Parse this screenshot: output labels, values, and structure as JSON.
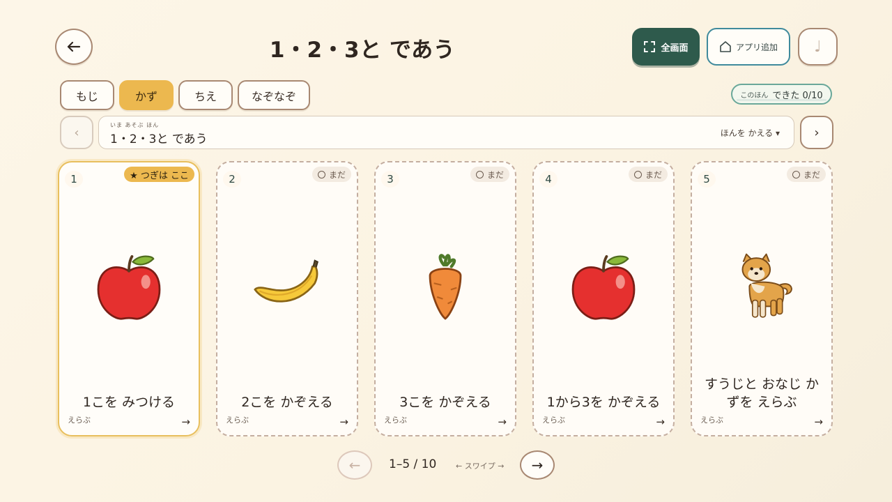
{
  "header": {
    "back_icon": "arrow-left-icon",
    "title": "1・2・3と であう",
    "fullscreen_label": "全画面",
    "fullscreen_icon": "expand-corners-icon",
    "add_app_label": "アプリ追加",
    "add_app_icon": "home-icon",
    "music_icon": "music-note-icon"
  },
  "tabs": [
    {
      "label": "もじ",
      "active": false
    },
    {
      "label": "かず",
      "active": true
    },
    {
      "label": "ちえ",
      "active": false
    },
    {
      "label": "なぞなぞ",
      "active": false
    }
  ],
  "progress": {
    "prefix": "このほん",
    "text": "できた 0/10",
    "fraction": 0.0
  },
  "book": {
    "ruby": "いま あそぶ ほん",
    "name": "1・2・3と であう",
    "change_label": "ほんを かえる ▾",
    "prev_icon": "‹",
    "next_icon": "›"
  },
  "cards": [
    {
      "number": "1",
      "badge": "★ つぎは ここ",
      "icon": "apple-icon",
      "label": "1こを みつける",
      "choose": "えらぶ",
      "arrow": "→",
      "current": true
    },
    {
      "number": "2",
      "badge": "まだ",
      "icon": "banana-icon",
      "label": "2こを かぞえる",
      "choose": "えらぶ",
      "arrow": "→",
      "current": false
    },
    {
      "number": "3",
      "badge": "まだ",
      "icon": "carrot-icon",
      "label": "3こを かぞえる",
      "choose": "えらぶ",
      "arrow": "→",
      "current": false
    },
    {
      "number": "4",
      "badge": "まだ",
      "icon": "apple-icon",
      "label": "1から3を かぞえる",
      "choose": "えらぶ",
      "arrow": "→",
      "current": false
    },
    {
      "number": "5",
      "badge": "まだ",
      "icon": "shiba-dog-icon",
      "label": "すうじと おなじ かずを えらぶ",
      "choose": "えらぶ",
      "arrow": "→",
      "current": false
    }
  ],
  "pager": {
    "prev_icon": "←",
    "next_icon": "→",
    "count": "1–5 / 10",
    "hint": "← スワイプ →"
  },
  "colors": {
    "accent": "#ecb84f",
    "primary_dark": "#2e5a4c",
    "border": "#a88872"
  }
}
